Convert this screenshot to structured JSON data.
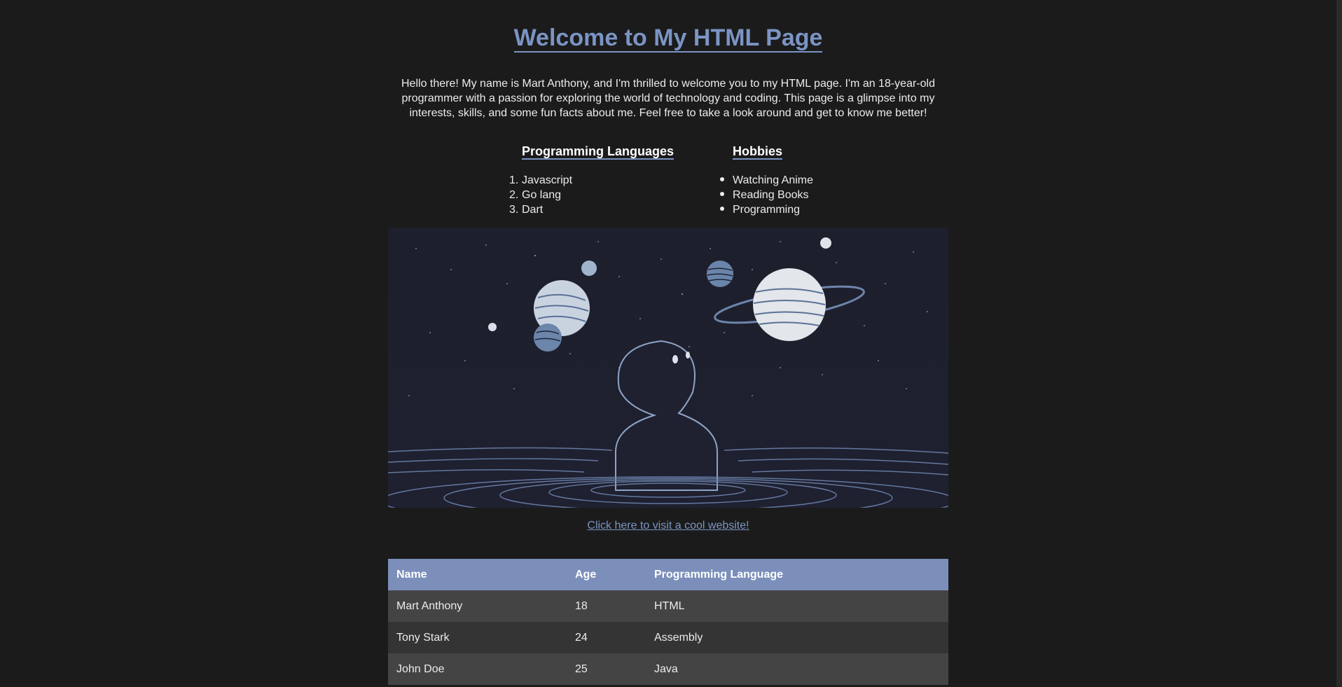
{
  "header": {
    "title": "Welcome to My HTML Page"
  },
  "intro": {
    "text": "Hello there! My name is Mart Anthony, and I'm thrilled to welcome you to my HTML page. I'm an 18-year-old programmer with a passion for exploring the world of technology and coding. This page is a glimpse into my interests, skills, and some fun facts about me. Feel free to take a look around and get to know me better!"
  },
  "languages": {
    "title": "Programming Languages",
    "items": [
      {
        "num": "1.",
        "label": "Javascript"
      },
      {
        "num": "2.",
        "label": "Go lang"
      },
      {
        "num": "3.",
        "label": "Dart"
      }
    ]
  },
  "hobbies": {
    "title": "Hobbies",
    "items": [
      "Watching Anime",
      "Reading Books",
      "Programming"
    ]
  },
  "link": {
    "label": "Click here to visit a cool website!"
  },
  "table": {
    "headers": [
      "Name",
      "Age",
      "Programming Language"
    ],
    "rows": [
      [
        "Mart Anthony",
        "18",
        "HTML"
      ],
      [
        "Tony Stark",
        "24",
        "Assembly"
      ],
      [
        "John Doe",
        "25",
        "Java"
      ]
    ]
  },
  "colors": {
    "background": "#1b1b1b",
    "accent": "#7b94c4",
    "table_header": "#7b8fba",
    "row_odd": "#444444",
    "row_even": "#343434"
  }
}
